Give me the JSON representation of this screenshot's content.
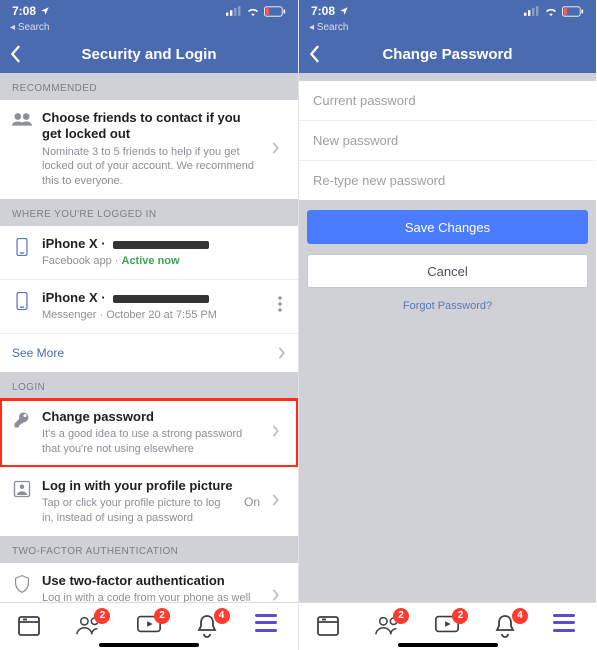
{
  "status": {
    "time": "7:08",
    "back_label": "Search"
  },
  "left": {
    "title": "Security and Login",
    "sec_recommended": "RECOMMENDED",
    "friends": {
      "title": "Choose friends to contact if you get locked out",
      "sub": "Nominate 3 to 5 friends to help if you get locked out of your account. We recommend this to everyone."
    },
    "sec_logged": "WHERE YOU'RE LOGGED IN",
    "dev1": {
      "name": "iPhone X",
      "app": "Facebook app",
      "status": "Active now"
    },
    "dev2": {
      "name": "iPhone X",
      "app": "Messenger",
      "time": "October 20 at 7:55 PM"
    },
    "see_more": "See More",
    "sec_login": "LOGIN",
    "change_pw": {
      "title": "Change password",
      "sub": "It's a good idea to use a strong password that you're not using elsewhere"
    },
    "profile_pic": {
      "title": "Log in with your profile picture",
      "sub": "Tap or click your profile picture to log in, instead of using a password",
      "state": "On"
    },
    "sec_2fa": "TWO-FACTOR AUTHENTICATION",
    "twofa": {
      "title": "Use two-factor authentication",
      "sub": "Log in with a code from your phone as well as a password"
    }
  },
  "right": {
    "title": "Change Password",
    "ph_current": "Current password",
    "ph_new": "New password",
    "ph_retype": "Re-type new password",
    "save": "Save Changes",
    "cancel": "Cancel",
    "forgot": "Forgot Password?"
  },
  "tabs": {
    "b1": "2",
    "b2": "2",
    "b3": "4"
  }
}
